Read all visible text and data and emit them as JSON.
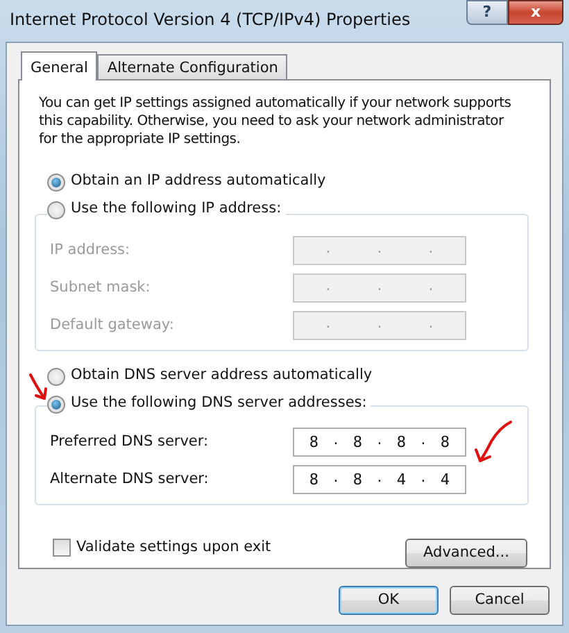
{
  "window": {
    "title": "Internet Protocol Version 4 (TCP/IPv4) Properties",
    "help_button": "?",
    "close_button": "x"
  },
  "tabs": [
    {
      "label": "General",
      "selected": true
    },
    {
      "label": "Alternate Configuration",
      "selected": false
    }
  ],
  "intro": "You can get IP settings assigned automatically if your network supports this capability. Otherwise, you need to ask your network administrator for the appropriate IP settings.",
  "separator": ".",
  "ip_options": [
    {
      "label": "Obtain an IP address automatically",
      "selected": true
    },
    {
      "label": "Use the following IP address:",
      "selected": false
    }
  ],
  "ip_fields": [
    {
      "label": "IP address:",
      "disabled": true
    },
    {
      "label": "Subnet mask:",
      "disabled": true
    },
    {
      "label": "Default gateway:",
      "disabled": true
    }
  ],
  "dns_options": [
    {
      "label": "Obtain DNS server address automatically",
      "selected": false
    },
    {
      "label": "Use the following DNS server addresses:",
      "selected": true
    }
  ],
  "dns_fields": [
    {
      "label": "Preferred DNS server:",
      "disabled": false,
      "octets": [
        "8",
        "8",
        "8",
        "8"
      ]
    },
    {
      "label": "Alternate DNS server:",
      "disabled": false,
      "octets": [
        "8",
        "8",
        "4",
        "4"
      ]
    }
  ],
  "validate": {
    "label": "Validate settings upon exit",
    "checked": false
  },
  "buttons": {
    "advanced": "Advanced...",
    "ok": "OK",
    "cancel": "Cancel"
  }
}
